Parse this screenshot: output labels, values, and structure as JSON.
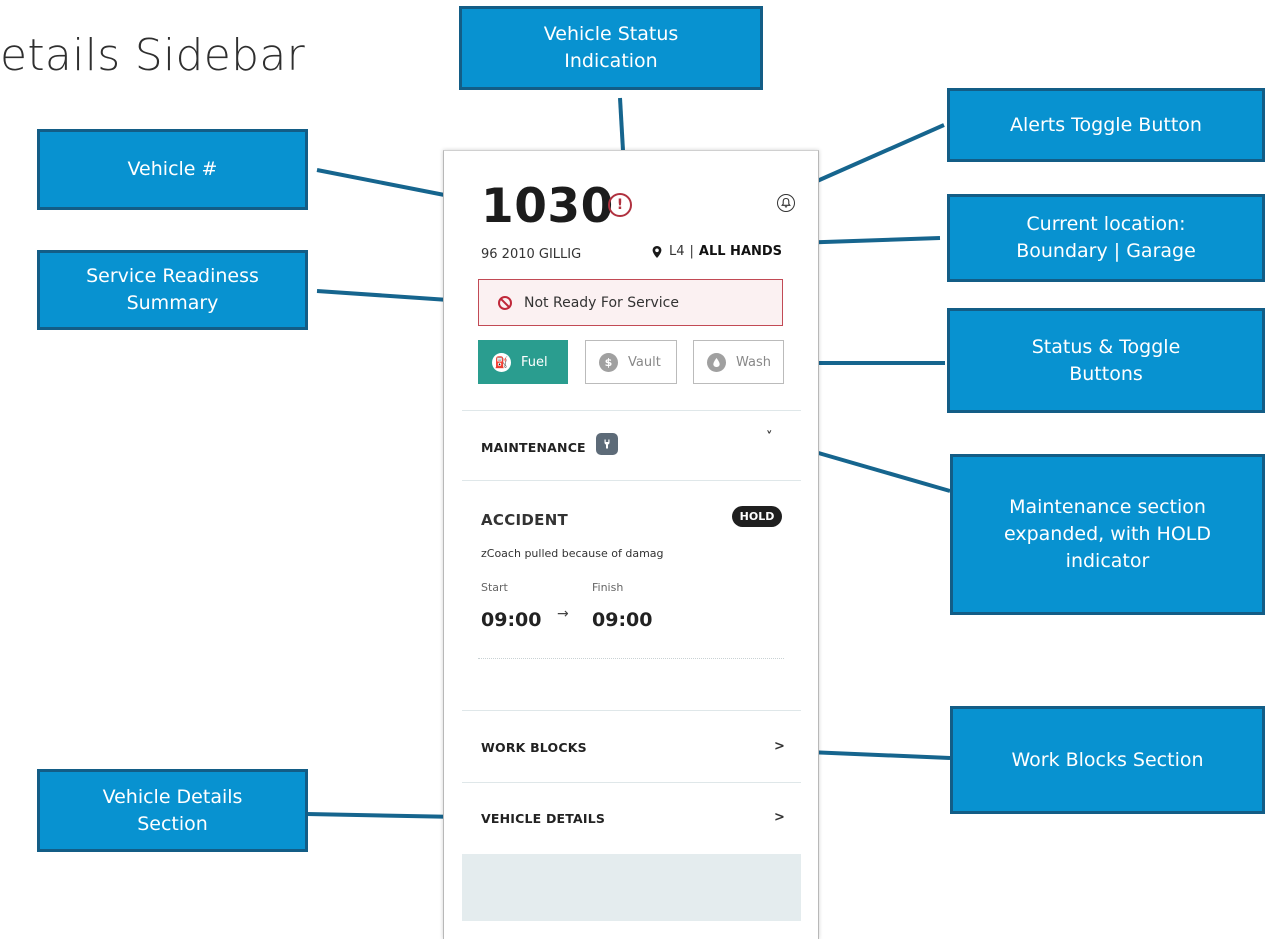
{
  "slide": {
    "title": "etails Sidebar"
  },
  "callouts": {
    "vehicle_status": "Vehicle Status Indication",
    "alerts_toggle": "Alerts Toggle Button",
    "vehicle_number": "Vehicle #",
    "current_location": "Current location: Boundary | Garage",
    "service_readiness": "Service Readiness Summary",
    "status_toggle": "Status & Toggle Buttons",
    "maintenance": "Maintenance section expanded, with HOLD indicator",
    "work_blocks": "Work Blocks Section",
    "vehicle_details": "Vehicle Details Section"
  },
  "panel": {
    "vehicle_number": "1030",
    "status_icon": "!",
    "vehicle_model": "96 2010 GILLIG",
    "location": {
      "boundary": "L4",
      "separator": "|",
      "garage": "ALL HANDS"
    },
    "readiness": "Not Ready For Service",
    "toggles": [
      {
        "label": "Fuel",
        "icon": "fuel-icon",
        "glyph": "⛽",
        "active": true
      },
      {
        "label": "Vault",
        "icon": "dollar-icon",
        "glyph": "$",
        "active": false
      },
      {
        "label": "Wash",
        "icon": "water-drop-icon",
        "glyph": "💧",
        "active": false
      }
    ],
    "maintenance": {
      "label": "MAINTENANCE",
      "chevron": "˅",
      "item": {
        "title": "ACCIDENT",
        "badge": "HOLD",
        "description": "zCoach pulled because of damag",
        "start_label": "Start",
        "finish_label": "Finish",
        "start_time": "09:00",
        "arrow": "→",
        "finish_time": "09:00"
      }
    },
    "work_blocks": {
      "label": "WORK BLOCKS",
      "chevron": ">"
    },
    "vehicle_details": {
      "label": "VEHICLE DETAILS",
      "chevron": ">"
    }
  },
  "colors": {
    "callout_fill": "#0892d0",
    "callout_border": "#135d86",
    "connector": "#16658e",
    "fuel_active": "#2a9d8f",
    "alert_red": "#b0313f"
  }
}
